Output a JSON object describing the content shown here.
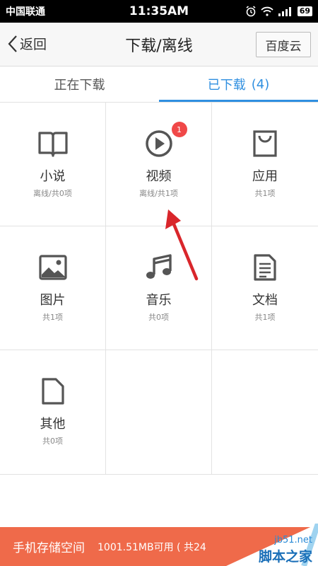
{
  "status": {
    "carrier": "中国联通",
    "time": "11:35AM",
    "battery": "69"
  },
  "header": {
    "back_label": "返回",
    "title": "下载/离线",
    "cloud_label": "百度云"
  },
  "tabs": [
    {
      "label": "正在下载",
      "count": "",
      "active": false
    },
    {
      "label": "已下载",
      "count": "(4)",
      "active": true
    }
  ],
  "grid": [
    {
      "name": "小说",
      "sub": "离线/共0项",
      "icon": "book-icon"
    },
    {
      "name": "视频",
      "sub": "离线/共1项",
      "icon": "play-icon",
      "badge": "1"
    },
    {
      "name": "应用",
      "sub": "共1项",
      "icon": "shopping-bag-icon"
    },
    {
      "name": "图片",
      "sub": "共1项",
      "icon": "image-icon"
    },
    {
      "name": "音乐",
      "sub": "共0项",
      "icon": "music-note-icon"
    },
    {
      "name": "文档",
      "sub": "共1项",
      "icon": "document-icon"
    },
    {
      "name": "其他",
      "sub": "共0项",
      "icon": "file-icon"
    }
  ],
  "storage": {
    "label": "手机存储空间",
    "info": "1001.51MB可用 ( 共24"
  },
  "watermark": {
    "url": "jb51.net",
    "text": "脚本之家"
  },
  "colors": {
    "accent": "#2f8fe0",
    "badge": "#f04848",
    "storage_bar": "#ef6a4a",
    "annotation_arrow": "#d9262b"
  }
}
